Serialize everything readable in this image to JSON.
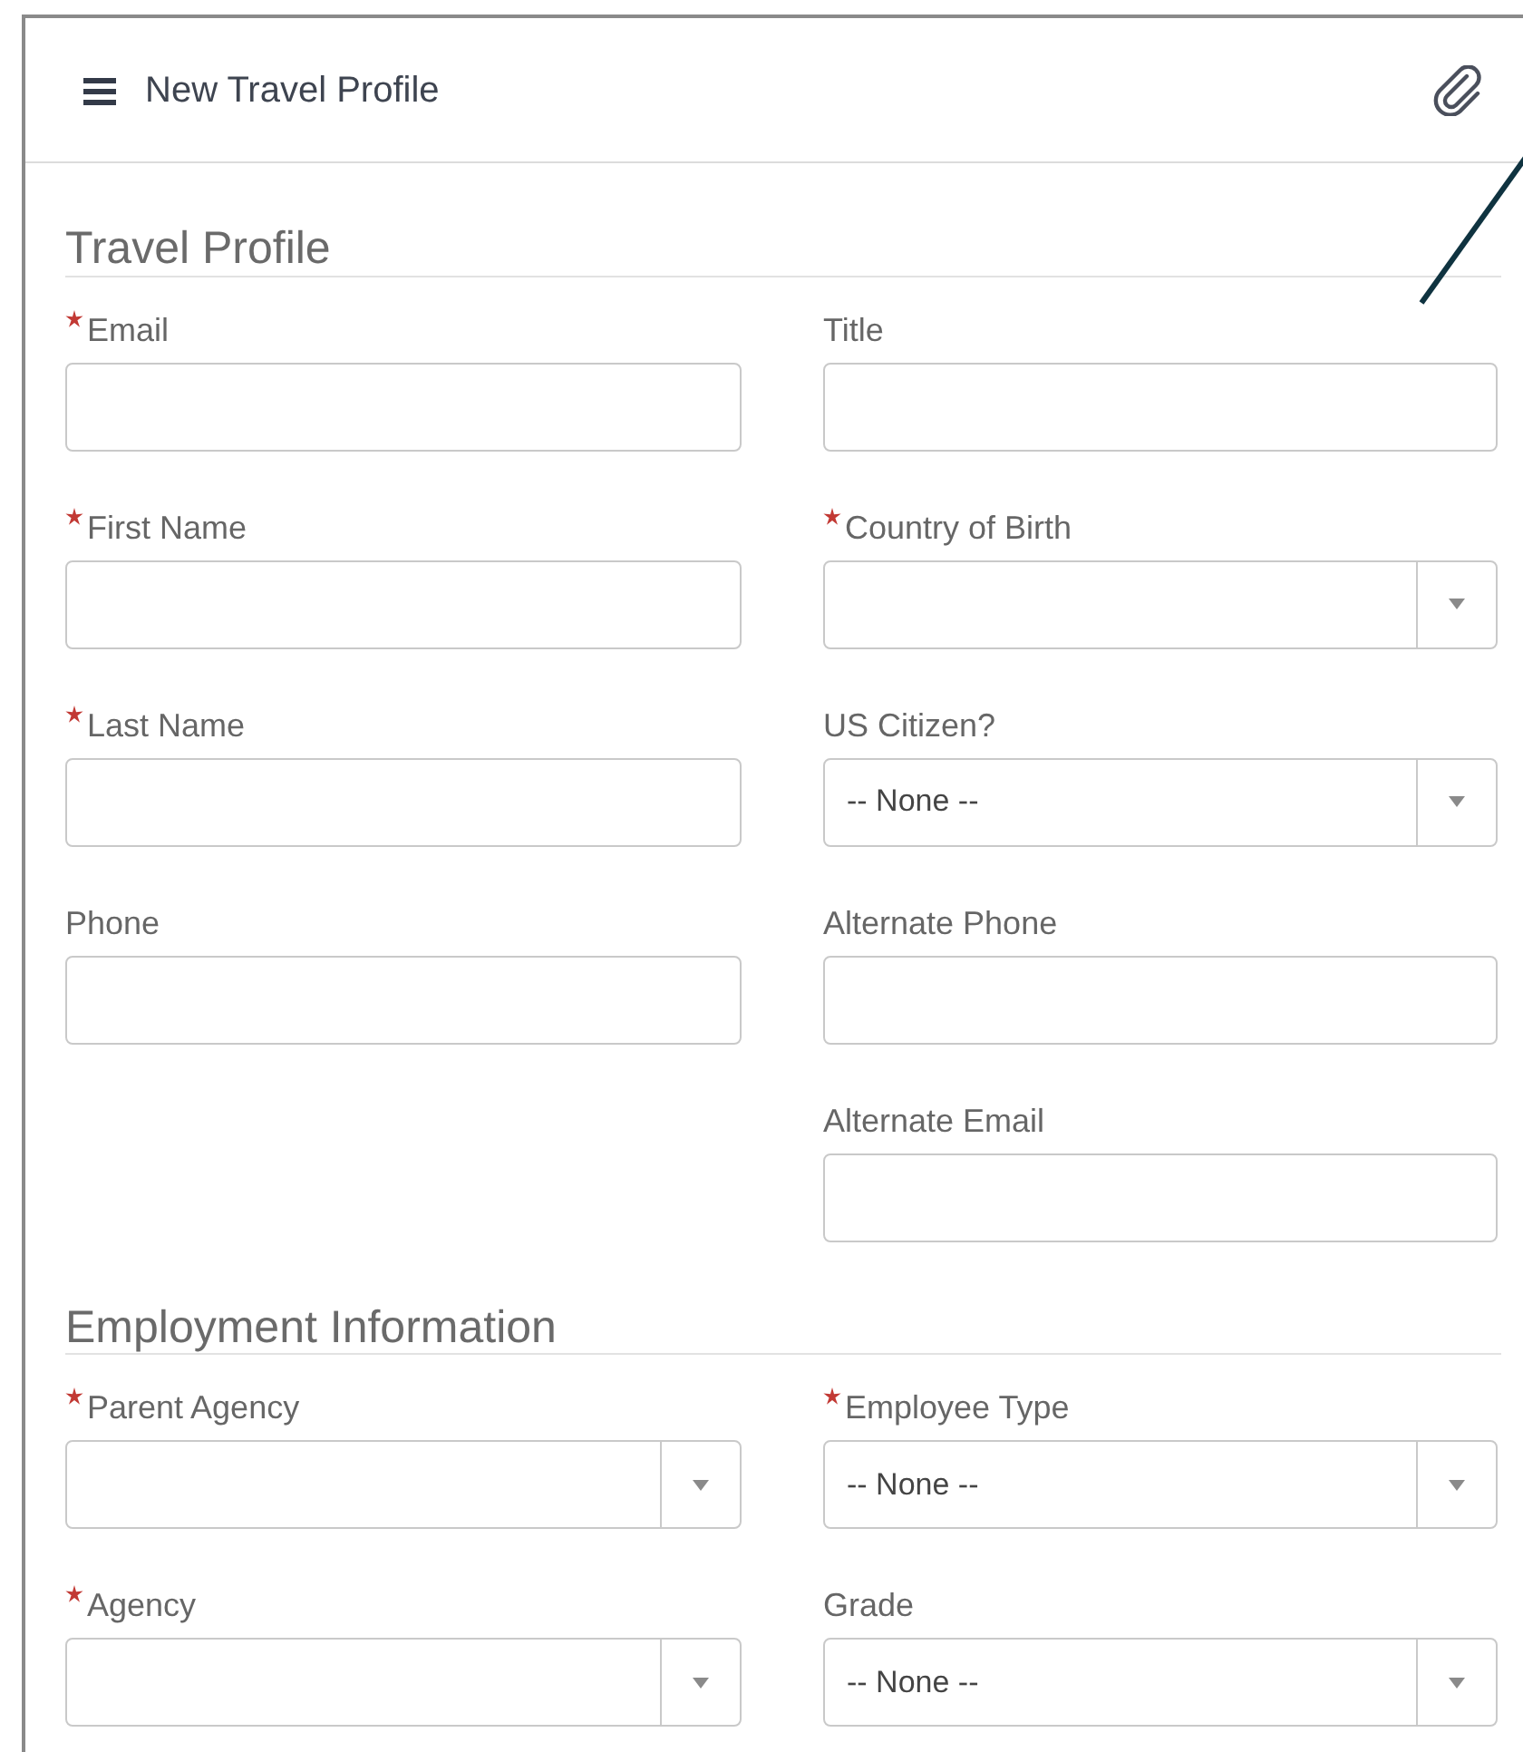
{
  "header": {
    "title": "New Travel Profile"
  },
  "sections": [
    {
      "title": "Travel Profile",
      "rows": [
        {
          "left": {
            "label": "Email",
            "required": true,
            "kind": "text"
          },
          "right": {
            "label": "Title",
            "required": false,
            "kind": "text"
          }
        },
        {
          "left": {
            "label": "First Name",
            "required": true,
            "kind": "text"
          },
          "right": {
            "label": "Country of Birth",
            "required": true,
            "kind": "select"
          }
        },
        {
          "left": {
            "label": "Last Name",
            "required": true,
            "kind": "text"
          },
          "right": {
            "label": "US Citizen?",
            "required": false,
            "kind": "select",
            "value": "-- None --"
          }
        },
        {
          "left": {
            "label": "Phone",
            "required": false,
            "kind": "text"
          },
          "right": {
            "label": "Alternate Phone",
            "required": false,
            "kind": "text"
          }
        },
        {
          "right": {
            "label": "Alternate Email",
            "required": false,
            "kind": "text"
          }
        }
      ]
    },
    {
      "title": "Employment Information",
      "rows": [
        {
          "left": {
            "label": "Parent Agency",
            "required": true,
            "kind": "select"
          },
          "right": {
            "label": "Employee Type",
            "required": true,
            "kind": "select",
            "value": "-- None --"
          }
        },
        {
          "left": {
            "label": "Agency",
            "required": true,
            "kind": "select"
          },
          "right": {
            "label": "Grade",
            "required": false,
            "kind": "select",
            "value": "-- None --"
          }
        }
      ]
    }
  ]
}
